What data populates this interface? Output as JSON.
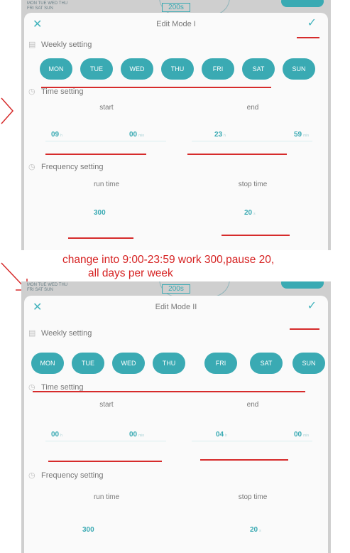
{
  "top_panel": {
    "bg_days": [
      "MON TUE WED THU",
      "FRI SAT SUN"
    ],
    "bg_value": "200s",
    "title": "Edit Mode I",
    "weekly_label": "Weekly setting",
    "days": [
      "MON",
      "TUE",
      "WED",
      "THU",
      "FRI",
      "SAT",
      "SUN"
    ],
    "time_label": "Time setting",
    "start_label": "start",
    "end_label": "end",
    "start_hour": "09",
    "start_min": "00",
    "end_hour": "23",
    "end_min": "59",
    "freq_label": "Frequency setting",
    "run_label": "run time",
    "stop_label": "stop time",
    "run_value": "300",
    "stop_value": "20"
  },
  "annotation": {
    "line1": "change into 9:00-23:59 work 300,pause 20,",
    "line2": "all days per week"
  },
  "bottom_panel": {
    "bg_days": [
      "MON TUE WED THU",
      "FRI SAT SUN"
    ],
    "bg_value": "200s",
    "title": "Edit Mode II",
    "weekly_label": "Weekly setting",
    "days": [
      "MON",
      "TUE",
      "WED",
      "THU",
      "FRI",
      "SAT",
      "SUN"
    ],
    "time_label": "Time setting",
    "start_label": "start",
    "end_label": "end",
    "start_hour": "00",
    "start_min": "00",
    "end_hour": "04",
    "end_min": "00",
    "freq_label": "Frequency setting",
    "run_label": "run time",
    "stop_label": "stop time",
    "run_value": "300",
    "stop_value": "20"
  },
  "colors": {
    "accent": "#3aaab3",
    "annotation": "#d62b2b",
    "backdrop": "#cfcfcf"
  },
  "icons": {
    "close": "close-icon",
    "confirm": "check-icon",
    "calendar": "calendar-icon",
    "clock": "clock-icon"
  }
}
